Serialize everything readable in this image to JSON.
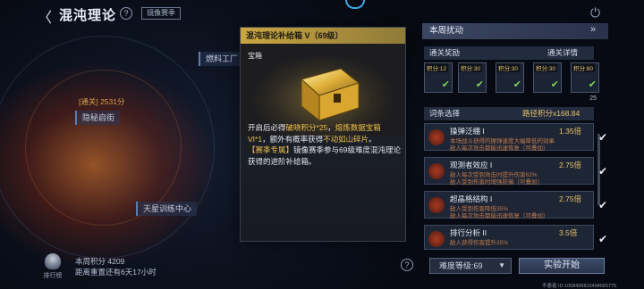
{
  "header": {
    "back_label": "〈",
    "title": "混沌理论",
    "help_label": "?",
    "season_badge": "镜像赛季",
    "power_icon": "power-icon"
  },
  "map": {
    "labels": [
      "燃料工厂",
      "隐秘启街",
      "天星训练中心"
    ],
    "clear_text": "[通关] 2531分",
    "weekly_score": "本周积分 4209",
    "reset_text": "距离重置还有6天17小时",
    "leaderboard_label": "排行榜"
  },
  "popup": {
    "title": "混沌理论补给箱 V（69级）",
    "item_type": "宝箱",
    "desc_pre": "开启后必得",
    "desc_hl1": "破晓积分*25",
    "desc_mid": "，",
    "desc_hl2": "熔炼数据宝箱VI*1",
    "desc_mid2": "，额外有概率获得",
    "desc_hl3": "不动如山碎片",
    "desc_end": "。",
    "season_tag": "【赛季专属】",
    "season_text": "镜像赛季参与69级难度混沌理论获得的进阶补给箱。"
  },
  "panel": {
    "title": "本周扰动",
    "clear_rewards_label": "通关奖励",
    "clear_details": "通关详情",
    "rewards": [
      {
        "tag": "积分:12",
        "num": ""
      },
      {
        "tag": "积分:30",
        "num": ""
      },
      {
        "tag": "积分:30",
        "num": ""
      },
      {
        "tag": "积分:30",
        "num": ""
      },
      {
        "tag": "积分:80",
        "num": "25"
      }
    ],
    "entries_label": "词条选择",
    "score_mult": "路径积分x168.84",
    "entries": [
      {
        "name": "操弹泛绷 I",
        "mult": "1.35倍",
        "line1": "本场战斗获得的操弹速度大幅降低的效果",
        "line2": "敌人每次攻击都能迅速恢复（可叠加）"
      },
      {
        "name": "观测者效应 I",
        "mult": "2.75倍",
        "line1": "敌人每次受到攻击时提升伤害62%",
        "line2": "敌人受到伤害时增强防御（可叠加）"
      },
      {
        "name": "超晶格结构 I",
        "mult": "2.75倍",
        "line1": "敌人受到伤害降低35%",
        "line2": "敌人每次攻击都能迅速恢复（可叠加）"
      },
      {
        "name": "排行分析 II",
        "mult": "3.5倍",
        "line1": "敌人获得伤害提升35%",
        "line2": ""
      }
    ],
    "difficulty": "难度等级:69",
    "start_label": "实验开始",
    "help_label": "?"
  },
  "uid": "不患者 ID:1058406816494665775",
  "colors": {
    "accent": "#c9a640",
    "highlight": "#f1c24a",
    "check": "#7fd35a"
  }
}
